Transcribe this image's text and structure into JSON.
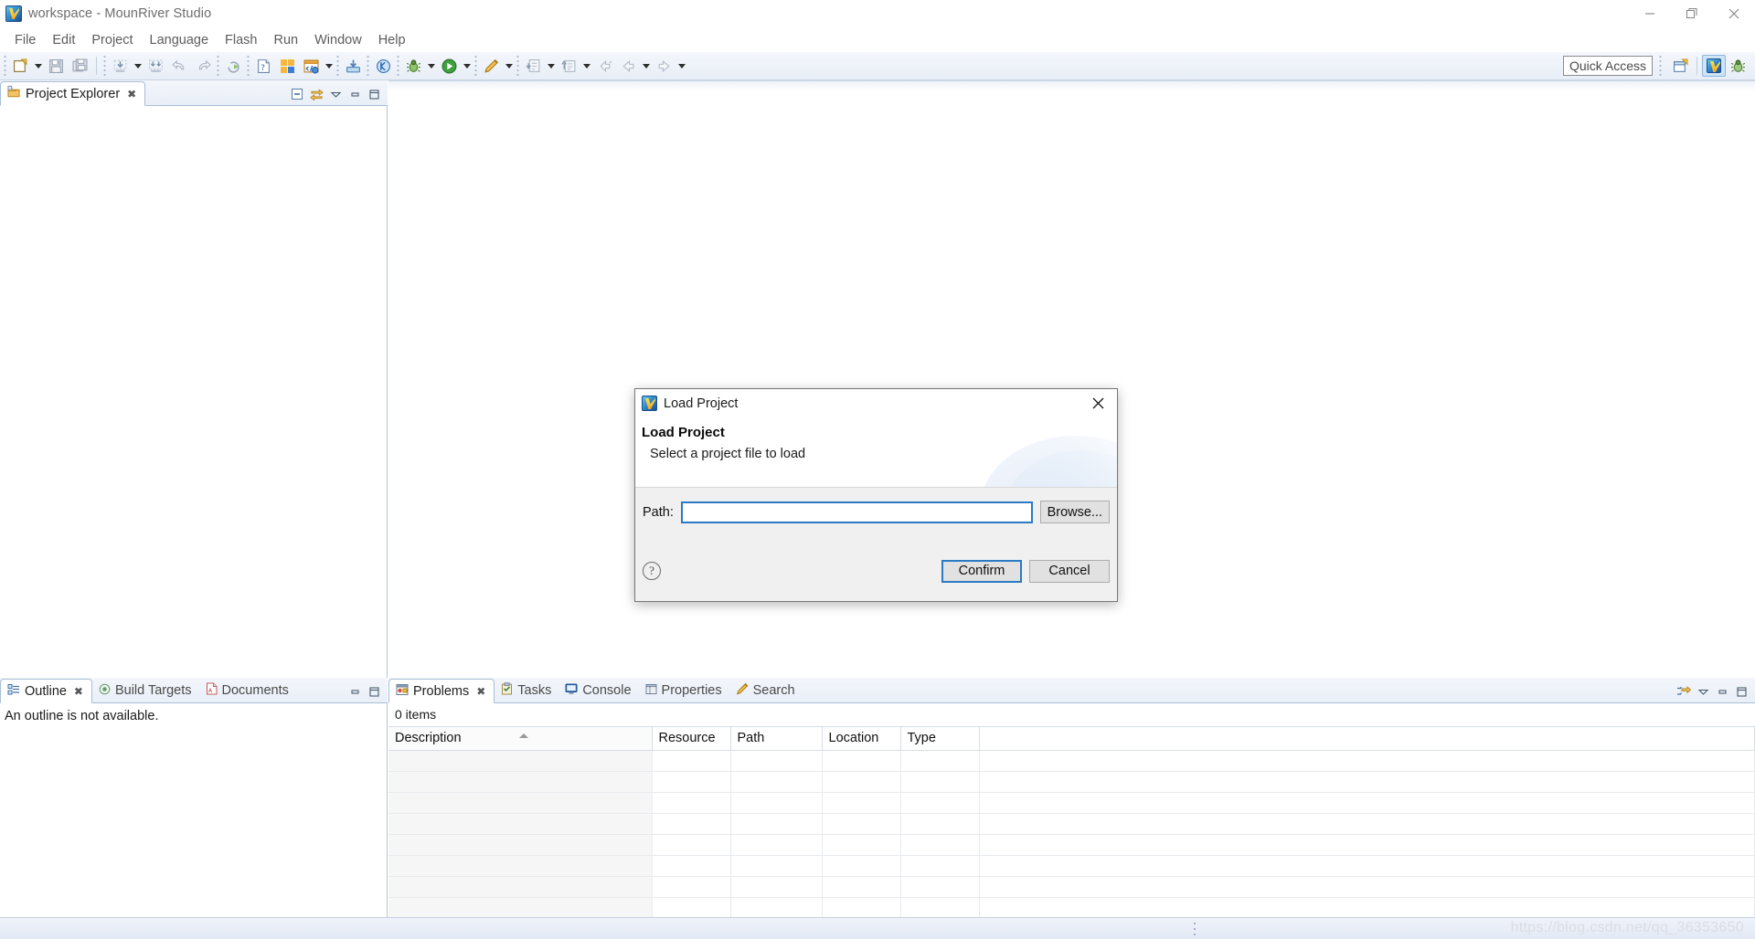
{
  "window": {
    "title": "workspace - MounRiver Studio",
    "app_icon": "mounriver-logo-icon",
    "controls": [
      {
        "name": "minimize-button",
        "glyph": "minimize-icon"
      },
      {
        "name": "maximize-button",
        "glyph": "restore-icon"
      },
      {
        "name": "close-button",
        "glyph": "close-icon"
      }
    ]
  },
  "menubar": {
    "items": [
      {
        "label": "File"
      },
      {
        "label": "Edit"
      },
      {
        "label": "Project"
      },
      {
        "label": "Language"
      },
      {
        "label": "Flash"
      },
      {
        "label": "Run"
      },
      {
        "label": "Window"
      },
      {
        "label": "Help"
      }
    ]
  },
  "toolbar": {
    "quick_access_placeholder": "Quick Access",
    "quick_access_value": "",
    "groups": [
      {
        "name": "file-group",
        "buttons": [
          "new-icon",
          "save-icon",
          "save-all-icon"
        ]
      },
      {
        "name": "build-group",
        "buttons": [
          "build-icon",
          "build-all-icon",
          "undo-icon",
          "redo-icon"
        ]
      },
      {
        "name": "run-group",
        "buttons": [
          "refresh-icon"
        ]
      },
      {
        "name": "doc-group",
        "buttons": [
          "help-doc-icon",
          "new-project-icon",
          "code-config-icon"
        ]
      },
      {
        "name": "download-group",
        "buttons": [
          "download-icon"
        ]
      },
      {
        "name": "target-group",
        "buttons": [
          "target-icon"
        ]
      },
      {
        "name": "debug-group",
        "buttons": [
          "debug-icon"
        ]
      },
      {
        "name": "launch-group",
        "buttons": [
          "run-icon"
        ]
      },
      {
        "name": "marker-group",
        "buttons": [
          "pencil-icon"
        ]
      },
      {
        "name": "nav-group",
        "buttons": [
          "next-annotation-icon",
          "previous-edit-icon",
          "back-icon",
          "forward-icon"
        ]
      }
    ],
    "perspective_buttons": [
      "open-perspective-icon",
      "mounriver-perspective-icon",
      "debug-perspective-icon"
    ]
  },
  "project_explorer": {
    "tab_label": "Project Explorer",
    "tab_icon": "project-explorer-icon",
    "tools": [
      "collapse-all-icon",
      "link-with-editor-icon",
      "view-menu-icon",
      "minimize-icon",
      "maximize-icon"
    ],
    "content": ""
  },
  "outline": {
    "tabs": [
      {
        "label": "Outline",
        "icon": "outline-icon",
        "active": true,
        "closable": true
      },
      {
        "label": "Build Targets",
        "icon": "build-targets-icon",
        "active": false,
        "closable": false
      },
      {
        "label": "Documents",
        "icon": "documents-pdf-icon",
        "active": false,
        "closable": false
      }
    ],
    "message": "An outline is not available.",
    "tools": [
      "minimize-icon",
      "maximize-icon"
    ]
  },
  "problems": {
    "tabs": [
      {
        "label": "Problems",
        "icon": "problems-icon",
        "active": true,
        "closable": true
      },
      {
        "label": "Tasks",
        "icon": "tasks-icon",
        "active": false,
        "closable": false
      },
      {
        "label": "Console",
        "icon": "console-icon",
        "active": false,
        "closable": false
      },
      {
        "label": "Properties",
        "icon": "properties-icon",
        "active": false,
        "closable": false
      },
      {
        "label": "Search",
        "icon": "search-icon",
        "active": false,
        "closable": false
      }
    ],
    "item_count_label": "0 items",
    "columns": [
      {
        "label": "Description",
        "sorted": true
      },
      {
        "label": "Resource",
        "sorted": false
      },
      {
        "label": "Path",
        "sorted": false
      },
      {
        "label": "Location",
        "sorted": false
      },
      {
        "label": "Type",
        "sorted": false
      },
      {
        "label": "",
        "sorted": false
      }
    ],
    "rows": [],
    "empty_row_count": 8,
    "tools": [
      "filters-icon",
      "view-menu-icon",
      "minimize-icon",
      "maximize-icon"
    ]
  },
  "dialog": {
    "window_title": "Load Project",
    "window_icon": "mounriver-logo-icon",
    "close_label": "close-icon",
    "heading": "Load Project",
    "subheading": "Select a project file to load",
    "path_label": "Path:",
    "path_value": "",
    "path_placeholder": "",
    "browse_label": "Browse...",
    "help_label": "?",
    "confirm_label": "Confirm",
    "cancel_label": "Cancel"
  },
  "statusbar": {
    "watermark": "https://blog.csdn.net/qq_36353650"
  },
  "colors": {
    "accent_blue": "#2a7ac4",
    "toolbar_top": "#f4f7fc",
    "toolbar_bottom": "#e8eef7",
    "dialog_bg": "#f0f0f0",
    "panel_border": "#a7bdd6"
  }
}
